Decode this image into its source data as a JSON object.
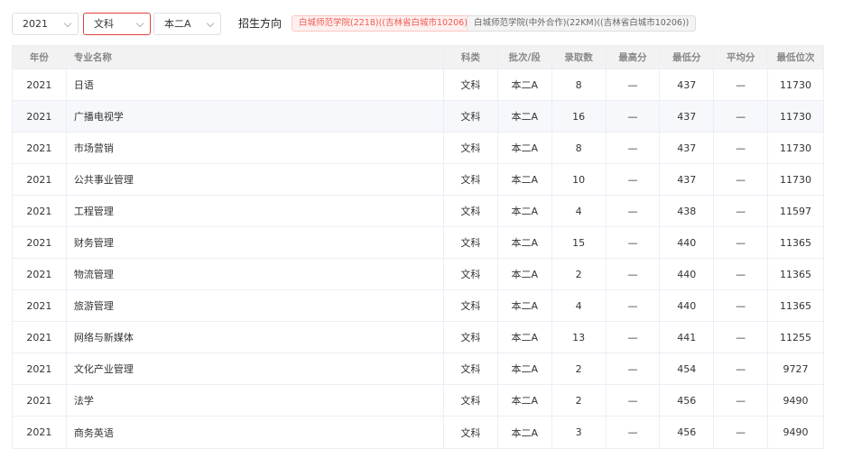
{
  "filters": {
    "year": "2021",
    "subject": "文科",
    "batch": "本二A",
    "direction_label": "招生方向",
    "tags": [
      "白城师范学院(2218)((吉林省白城市10206))",
      "白城师范学院(中外合作)(22KM)((吉林省白城市10206))"
    ]
  },
  "table": {
    "headers": [
      "年份",
      "专业名称",
      "科类",
      "批次/段",
      "录取数",
      "最高分",
      "最低分",
      "平均分",
      "最低位次"
    ],
    "rows": [
      [
        "2021",
        "日语",
        "文科",
        "本二A",
        "8",
        "—",
        "437",
        "—",
        "11730"
      ],
      [
        "2021",
        "广播电视学",
        "文科",
        "本二A",
        "16",
        "—",
        "437",
        "—",
        "11730"
      ],
      [
        "2021",
        "市场营销",
        "文科",
        "本二A",
        "8",
        "—",
        "437",
        "—",
        "11730"
      ],
      [
        "2021",
        "公共事业管理",
        "文科",
        "本二A",
        "10",
        "—",
        "437",
        "—",
        "11730"
      ],
      [
        "2021",
        "工程管理",
        "文科",
        "本二A",
        "4",
        "—",
        "438",
        "—",
        "11597"
      ],
      [
        "2021",
        "财务管理",
        "文科",
        "本二A",
        "15",
        "—",
        "440",
        "—",
        "11365"
      ],
      [
        "2021",
        "物流管理",
        "文科",
        "本二A",
        "2",
        "—",
        "440",
        "—",
        "11365"
      ],
      [
        "2021",
        "旅游管理",
        "文科",
        "本二A",
        "4",
        "—",
        "440",
        "—",
        "11365"
      ],
      [
        "2021",
        "网络与新媒体",
        "文科",
        "本二A",
        "13",
        "—",
        "441",
        "—",
        "11255"
      ],
      [
        "2021",
        "文化产业管理",
        "文科",
        "本二A",
        "2",
        "—",
        "454",
        "—",
        "9727"
      ],
      [
        "2021",
        "法学",
        "文科",
        "本二A",
        "2",
        "—",
        "456",
        "—",
        "9490"
      ],
      [
        "2021",
        "商务英语",
        "文科",
        "本二A",
        "3",
        "—",
        "456",
        "—",
        "9490"
      ]
    ]
  },
  "colors": {
    "accent": "#e0403a",
    "tag_red_text": "#f05a52",
    "header_bg": "#f2f2f2",
    "row_highlight": "#f6f8fc"
  }
}
